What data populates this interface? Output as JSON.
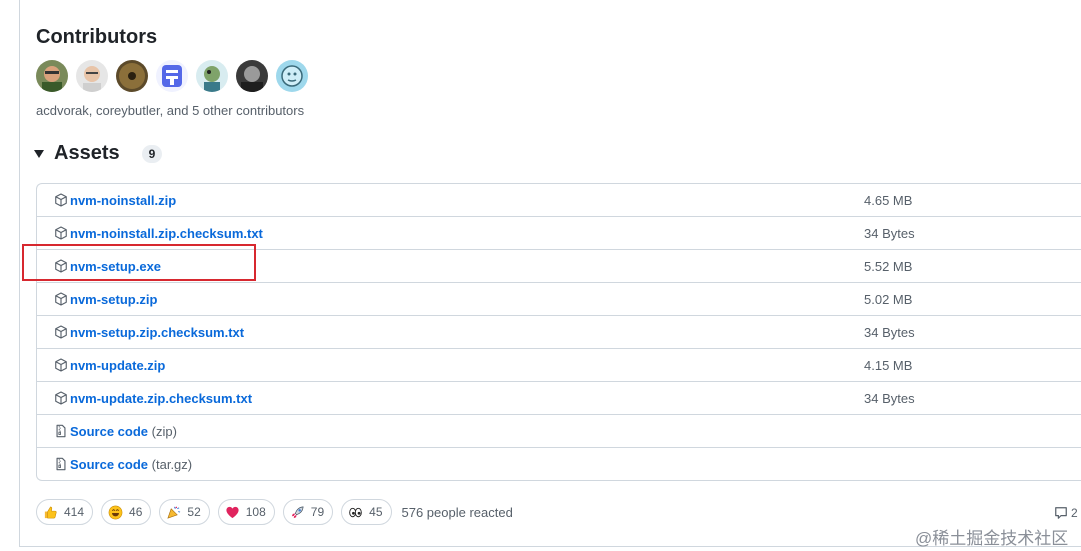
{
  "contributors": {
    "title": "Contributors",
    "summary": "acdvorak, coreybutler, and 5 other contributors",
    "avatars": [
      "avatar-1",
      "avatar-2",
      "avatar-3",
      "avatar-4",
      "avatar-5",
      "avatar-6",
      "avatar-7"
    ]
  },
  "assets": {
    "title": "Assets",
    "count": "9",
    "items": [
      {
        "name": "nvm-noinstall.zip",
        "suffix": "",
        "size": "4.65 MB",
        "icon": "package-icon"
      },
      {
        "name": "nvm-noinstall.zip.checksum.txt",
        "suffix": "",
        "size": "34 Bytes",
        "icon": "package-icon"
      },
      {
        "name": "nvm-setup.exe",
        "suffix": "",
        "size": "5.52 MB",
        "icon": "package-icon"
      },
      {
        "name": "nvm-setup.zip",
        "suffix": "",
        "size": "5.02 MB",
        "icon": "package-icon"
      },
      {
        "name": "nvm-setup.zip.checksum.txt",
        "suffix": "",
        "size": "34 Bytes",
        "icon": "package-icon"
      },
      {
        "name": "nvm-update.zip",
        "suffix": "",
        "size": "4.15 MB",
        "icon": "package-icon"
      },
      {
        "name": "nvm-update.zip.checksum.txt",
        "suffix": "",
        "size": "34 Bytes",
        "icon": "package-icon"
      },
      {
        "name": "Source code",
        "suffix": "(zip)",
        "size": "",
        "icon": "file-zip-icon"
      },
      {
        "name": "Source code",
        "suffix": "(tar.gz)",
        "size": "",
        "icon": "file-zip-icon"
      }
    ]
  },
  "reactions": {
    "items": [
      {
        "emoji": "thumbs-up",
        "count": "414"
      },
      {
        "emoji": "laugh",
        "count": "46"
      },
      {
        "emoji": "hooray",
        "count": "52"
      },
      {
        "emoji": "heart",
        "count": "108"
      },
      {
        "emoji": "rocket",
        "count": "79"
      },
      {
        "emoji": "eyes",
        "count": "45"
      }
    ],
    "summary": "576 people reacted"
  },
  "comment": {
    "count": "2"
  },
  "watermark": "@稀土掘金技术社区",
  "colors": {
    "link": "#0969da",
    "muted": "#57606a",
    "border": "#d0d7de",
    "highlight": "#d7282f"
  }
}
